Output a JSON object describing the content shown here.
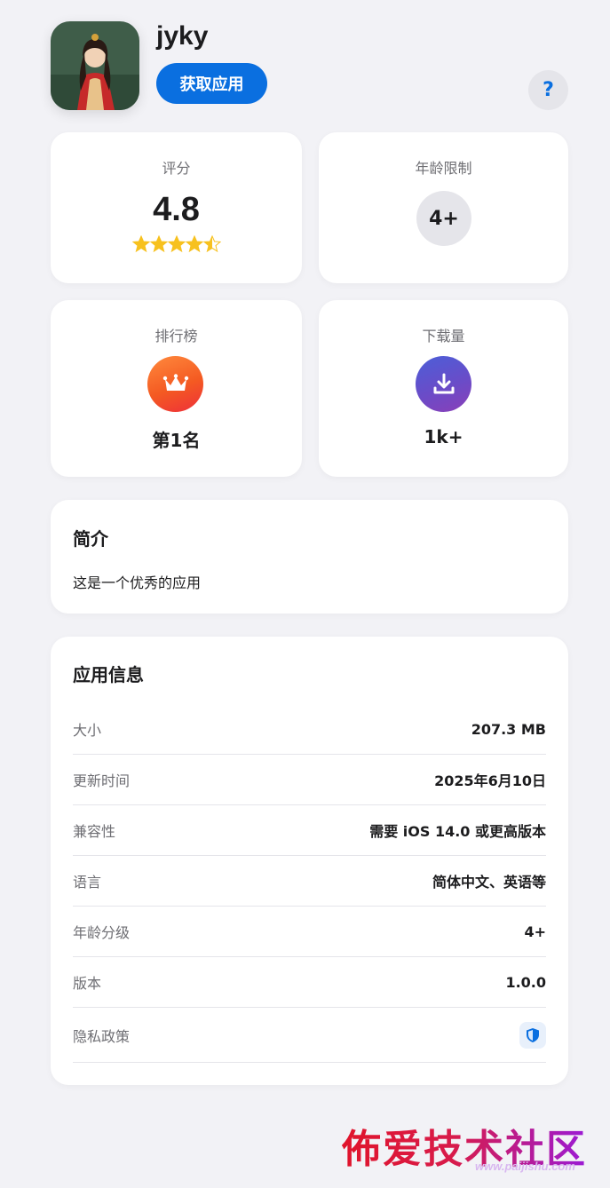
{
  "app": {
    "name": "jyky",
    "get_label": "获取应用",
    "help_label": "?"
  },
  "stats": {
    "rating": {
      "label": "评分",
      "value": "4.8",
      "stars": "★★★★⯪",
      "stars_value": 4.8
    },
    "age": {
      "label": "年龄限制",
      "value": "4+"
    },
    "ranking": {
      "label": "排行榜",
      "value": "第1名",
      "icon": "crown-icon"
    },
    "downloads": {
      "label": "下载量",
      "value": "1k+",
      "icon": "download-icon"
    }
  },
  "intro": {
    "title": "简介",
    "text": "这是一个优秀的应用"
  },
  "info": {
    "title": "应用信息",
    "rows": [
      {
        "label": "大小",
        "value": "207.3 MB"
      },
      {
        "label": "更新时间",
        "value": "2025年6月10日"
      },
      {
        "label": "兼容性",
        "value": "需要 iOS 14.0 或更高版本"
      },
      {
        "label": "语言",
        "value": "简体中文、英语等"
      },
      {
        "label": "年龄分级",
        "value": "4+"
      },
      {
        "label": "版本",
        "value": "1.0.0"
      },
      {
        "label": "隐私政策",
        "value": "",
        "icon": "shield-icon"
      }
    ]
  },
  "watermark": {
    "text": "佈爱技术社区",
    "url": "www.paijishu.com"
  },
  "colors": {
    "accent": "#0a6fe0",
    "background": "#f2f2f6",
    "star": "#f7c11e"
  }
}
